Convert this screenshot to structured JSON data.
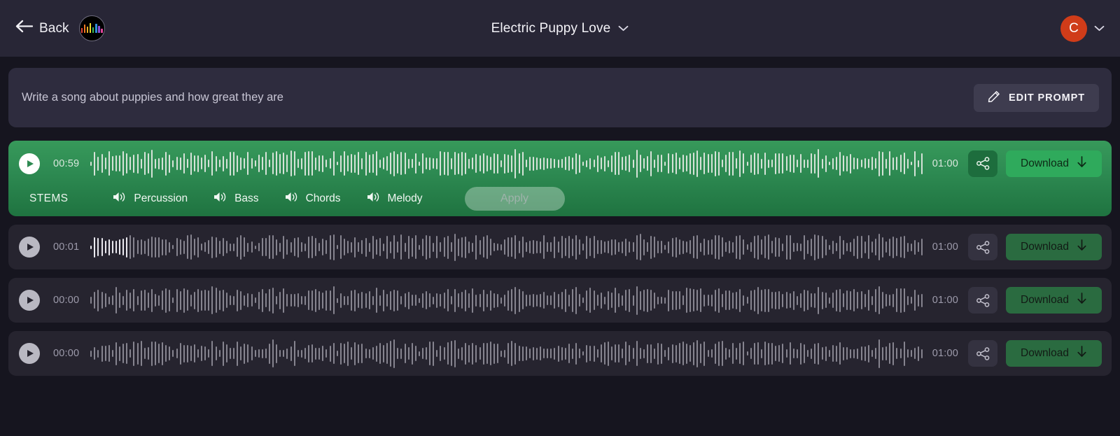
{
  "header": {
    "back_label": "Back",
    "back_icon": "arrow-left-icon",
    "logo_icon": "app-logo-equalizer-icon",
    "logo_bars": [
      {
        "color": "#e8433a",
        "h": 7
      },
      {
        "color": "#f07a22",
        "h": 12
      },
      {
        "color": "#f3b021",
        "h": 9
      },
      {
        "color": "#eede2b",
        "h": 14
      },
      {
        "color": "#3fbf52",
        "h": 8
      },
      {
        "color": "#2f8fd8",
        "h": 13
      },
      {
        "color": "#8a4fd6",
        "h": 10
      },
      {
        "color": "#e0459c",
        "h": 6
      }
    ],
    "title": "Electric Puppy Love",
    "title_chevron_icon": "chevron-down-icon",
    "avatar_initial": "C",
    "avatar_color": "#d03c19",
    "user_chevron_icon": "chevron-down-icon"
  },
  "prompt": {
    "text": "Write a song about puppies and how great they are",
    "edit_button_label": "EDIT PROMPT",
    "edit_button_icon": "pencil-icon"
  },
  "stems": {
    "label": "STEMS",
    "items": [
      {
        "label": "Percussion",
        "icon": "speaker-icon"
      },
      {
        "label": "Bass",
        "icon": "speaker-icon"
      },
      {
        "label": "Chords",
        "icon": "speaker-icon"
      },
      {
        "label": "Melody",
        "icon": "speaker-icon"
      }
    ],
    "apply_label": "Apply",
    "apply_disabled": true
  },
  "common": {
    "play_icon": "play-icon",
    "share_icon": "share-icon",
    "download_label": "Download",
    "download_icon": "arrow-down-icon"
  },
  "tracks": [
    {
      "current_time": "00:59",
      "duration": "01:00",
      "active": true,
      "progress_percent": 0,
      "download_label": "Download",
      "share_icon": "share-icon"
    },
    {
      "current_time": "00:01",
      "duration": "01:00",
      "active": false,
      "progress_percent": 4,
      "download_label": "Download",
      "share_icon": "share-icon"
    },
    {
      "current_time": "00:00",
      "duration": "01:00",
      "active": false,
      "progress_percent": 0,
      "download_label": "Download",
      "share_icon": "share-icon"
    },
    {
      "current_time": "00:00",
      "duration": "01:00",
      "active": false,
      "progress_percent": 0,
      "download_label": "Download",
      "share_icon": "share-icon"
    }
  ],
  "colors": {
    "background": "#16151f",
    "header_bg": "#282636",
    "prompt_bg": "#2e2c3e",
    "track_bg": "#26242f",
    "active_green_top": "#37995a",
    "active_green_bottom": "#1f7340",
    "download_green": "#2faa5c",
    "accent_orange": "#d03c19"
  }
}
